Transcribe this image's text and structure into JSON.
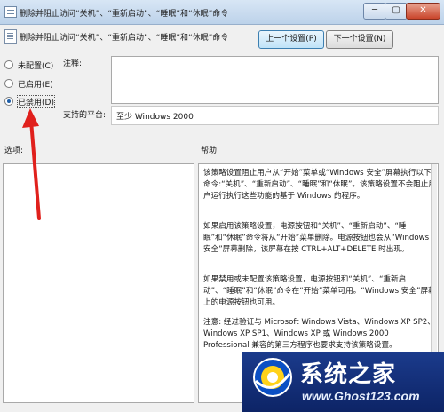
{
  "window": {
    "title": "删除并阻止访问“关机”、“重新启动”、“睡眠”和“休眠”命令",
    "controls": {
      "minimize": "─",
      "maximize": "▢",
      "close": "✕"
    }
  },
  "header": {
    "policy_title": "删除并阻止访问“关机”、“重新启动”、“睡眠”和“休眠”命令",
    "prev_button": "上一个设置(P)",
    "next_button": "下一个设置(N)"
  },
  "state": {
    "options": [
      {
        "label": "未配置(C)",
        "selected": false
      },
      {
        "label": "已启用(E)",
        "selected": false
      },
      {
        "label": "已禁用(D)",
        "selected": true
      }
    ]
  },
  "comment": {
    "label": "注释:",
    "value": ""
  },
  "platform": {
    "label": "支持的平台:",
    "value": "至少 Windows 2000"
  },
  "options_pane": {
    "label": "选项:"
  },
  "help": {
    "label": "帮助:",
    "paragraphs": [
      "该策略设置阻止用户从“开始”菜单或“Windows 安全”屏幕执行以下命令:“关机”、“重新启动”、“睡眠”和“休眠”。该策略设置不会阻止用户运行执行这些功能的基于 Windows 的程序。",
      "如果启用该策略设置，电源按钮和“关机”、“重新启动”、“睡眠”和“休眠”命令将从“开始”菜单删除。电源按钮也会从“Windows 安全”屏幕删除，该屏幕在按 CTRL+ALT+DELETE 时出现。",
      "如果禁用或未配置该策略设置，电源按钮和“关机”、“重新启动”、“睡眠”和“休眠”命令在“开始”菜单可用。“Windows 安全”屏幕上的电源按钮也可用。",
      "注意: 经过验证与 Microsoft Windows Vista、Windows XP SP2、Windows XP SP1、Windows XP 或 Windows 2000 Professional 兼容的第三方程序也要求支持该策略设置。"
    ]
  },
  "annotation": {
    "icon": "red-arrow-icon",
    "color": "#e0201c"
  },
  "watermark": {
    "name": "系统之家",
    "url": "www.Ghost123.com",
    "bg_color": "#1b3b8c"
  }
}
